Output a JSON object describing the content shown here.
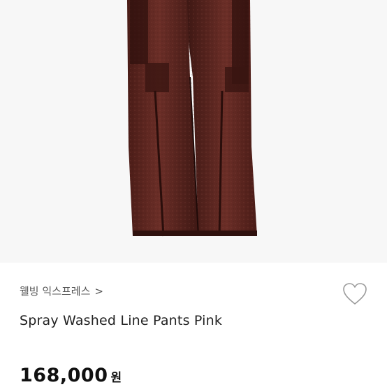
{
  "product": {
    "brand": "웰빙 익스프레스",
    "brand_chevron": ">",
    "name": "Spray Washed Line Pants Pink",
    "price": "168,000",
    "currency": "원"
  },
  "icons": {
    "like": "heart-outline-icon",
    "chevron": "chevron-right-icon"
  },
  "colors": {
    "denim": "#5a2620",
    "denim_dark": "#3a1612",
    "background": "#ffffff",
    "text": "#222222"
  }
}
